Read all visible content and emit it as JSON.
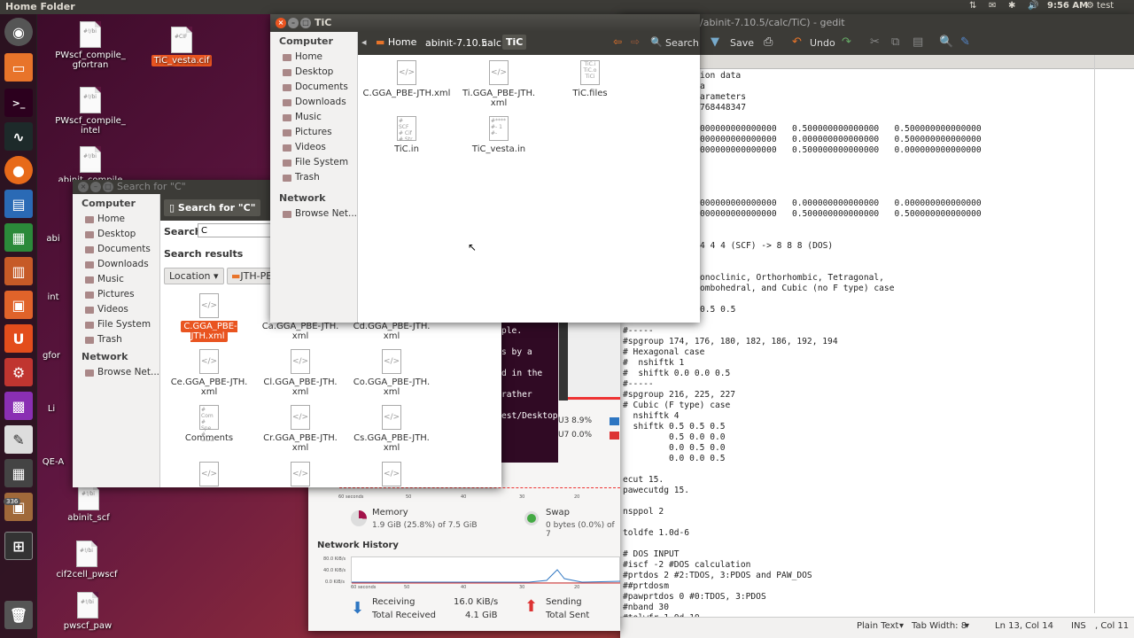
{
  "top_panel": {
    "title": "Home Folder",
    "time": "9:56 AM",
    "user": "test"
  },
  "launcher": {
    "badge": "336"
  },
  "desktop": {
    "icons": [
      "PWscf_compile_\ngfortran",
      "PWscf_compile_\nintel",
      "abinit_compile",
      "int",
      "abi",
      "gfor",
      "Li",
      "QE-A",
      "abinit_scf",
      "cif2cell_pwscf",
      "pwscf_paw",
      "TiC_vesta.cif"
    ]
  },
  "gedit": {
    "title": "/abinit-7.10.5/calc/TiC) - gedit",
    "toolbar": {
      "save": "Save",
      "undo": "Undo"
    },
    "lines_top": [
      "ion data",
      "a",
      "arameters",
      "768448347",
      "",
      "000000000000000   0.500000000000000   0.500000000000000",
      "000000000000000   0.000000000000000   0.500000000000000",
      "000000000000000   0.500000000000000   0.000000000000000",
      "",
      "",
      "",
      "",
      "000000000000000   0.000000000000000   0.000000000000000",
      "000000000000000   0.500000000000000   0.500000000000000",
      "",
      "",
      "4 4 4 (SCF) -> 8 8 8 (DOS)",
      "",
      "",
      "onoclinic, Orthorhombic, Tetragonal,",
      "ombohedral, and Cubic (no F type) case",
      "",
      "0.5 0.5"
    ],
    "lines_bottom": [
      "#-----",
      "#spgroup 174, 176, 180, 182, 186, 192, 194",
      "# Hexagonal case",
      "#  nshiftk 1",
      "#  shiftk 0.0 0.0 0.5",
      "#-----",
      "#spgroup 216, 225, 227",
      "# Cubic (F type) case",
      "  nshiftk 4",
      "  shiftk 0.5 0.5 0.5",
      "         0.5 0.0 0.0",
      "         0.0 0.5 0.0",
      "         0.0 0.0 0.5",
      "",
      "ecut 15.",
      "pawecutdg 15.",
      "",
      "nsppol 2",
      "",
      "toldfe 1.0d-6",
      "",
      "# DOS INPUT",
      "#iscf -2 #DOS calculation",
      "#prtdos 2 #2:TDOS, 3:PDOS and PAW_DOS",
      "##prtdosm",
      "#pawprtdos 0 #0:TDOS, 3:PDOS",
      "#nband 30",
      "#tolwfr 1.0d-10"
    ],
    "status": {
      "lang": "Plain Text",
      "tab": "Tab Width: 8",
      "pos": "Ln 13, Col 14",
      "mode": "INS",
      "extra": ", Col 11"
    }
  },
  "terminal": {
    "lines": [
      "ple.",
      "s by a",
      "",
      "d in the",
      "rather",
      "est/Desktop"
    ]
  },
  "sysmon": {
    "cpu3": "U3  8.9%",
    "cpu7": "U7  0.0%",
    "axis": [
      "60 seconds",
      "50",
      "40",
      "30",
      "20"
    ],
    "memory_label": "Memory",
    "memory_value": "1.9 GiB (25.8%) of 7.5 GiB",
    "swap_label": "Swap",
    "swap_value": "0 bytes (0.0%) of 7",
    "network_title": "Network History",
    "net_ticks": [
      "80.0 KiB/s",
      "40.0 KiB/s",
      "0.0 KiB/s"
    ],
    "receiving": "Receiving",
    "receiving_rate": "16.0 KiB/s",
    "total_received": "Total Received",
    "total_received_val": "4.1 GiB",
    "sending": "Sending",
    "total_sent": "Total Sent"
  },
  "files_tic": {
    "title": "TiC",
    "path": [
      "Home",
      "abinit-7.10.5",
      "calc",
      "TiC"
    ],
    "search": "Search",
    "sidebar_computer": "Computer",
    "places": [
      "Home",
      "Desktop",
      "Documents",
      "Downloads",
      "Music",
      "Pictures",
      "Videos",
      "File System",
      "Trash"
    ],
    "sidebar_network": "Network",
    "network_items": [
      "Browse Net..."
    ],
    "files": [
      "C.GGA_PBE-JTH.xml",
      "Ti.GGA_PBE-JTH.\nxml",
      "TiC.files",
      "TiC.in",
      "TiC_vesta.in"
    ]
  },
  "files_search": {
    "title": "Search for \"C\"",
    "header": "Search for \"C\"",
    "search_label": "Search:",
    "search_value": "C",
    "results_label": "Search results",
    "location": "Location",
    "crumb": "JTH-PBE",
    "sidebar_computer": "Computer",
    "places": [
      "Home",
      "Desktop",
      "Documents",
      "Downloads",
      "Music",
      "Pictures",
      "Videos",
      "File System",
      "Trash"
    ],
    "sidebar_network": "Network",
    "network_items": [
      "Browse Net..."
    ],
    "files": [
      "C.GGA_PBE-JTH.xml",
      "Ca.GGA_PBE-JTH.\nxml",
      "Cd.GGA_PBE-JTH.\nxml",
      "Ce.GGA_PBE-JTH.\nxml",
      "Cl.GGA_PBE-JTH.\nxml",
      "Co.GGA_PBE-JTH.\nxml",
      "Comments",
      "Cr.GGA_PBE-JTH.\nxml",
      "Cs.GGA_PBE-JTH.\nxml"
    ]
  }
}
